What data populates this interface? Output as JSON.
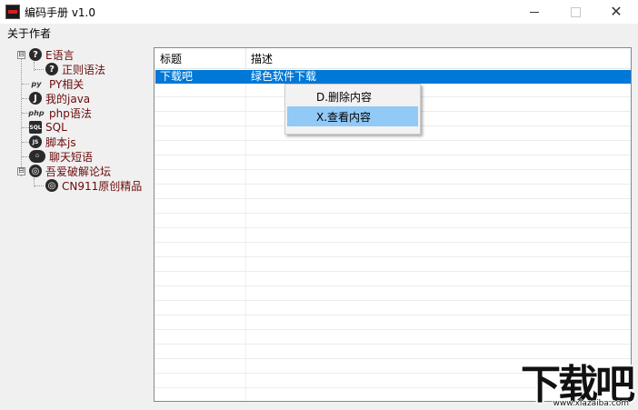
{
  "window": {
    "title": "编码手册 v1.0",
    "minimize_glyph": "",
    "close_glyph": "✕"
  },
  "menu": {
    "items": [
      "关于作者"
    ]
  },
  "tree": {
    "nodes": [
      {
        "label": "E语言",
        "icon": "question-icon",
        "glyph": "?",
        "expander": "⊟"
      },
      {
        "label": "正则语法",
        "icon": "question-icon",
        "glyph": "?"
      },
      {
        "label": "PY相关",
        "icon": "python-icon",
        "glyph": "py"
      },
      {
        "label": "我的java",
        "icon": "java-icon",
        "glyph": "J"
      },
      {
        "label": "php语法",
        "icon": "php-icon",
        "glyph": "php"
      },
      {
        "label": "SQL",
        "icon": "sql-icon",
        "glyph": "SQL"
      },
      {
        "label": "脚本js",
        "icon": "js-icon",
        "glyph": "JS"
      },
      {
        "label": "聊天短语",
        "icon": "chat-icon",
        "glyph": "◦"
      },
      {
        "label": "吾爱破解论坛",
        "icon": "forum-icon",
        "glyph": "◎",
        "expander": "⊟"
      },
      {
        "label": "CN911原创精品",
        "icon": "forum-icon",
        "glyph": "◎"
      }
    ]
  },
  "list": {
    "columns": [
      "标题",
      "描述"
    ],
    "rows": [
      {
        "title": "下载吧",
        "description": "绿色软件下载",
        "selected": true
      }
    ]
  },
  "context_menu": {
    "items": [
      {
        "label": "D.删除内容",
        "highlighted": false
      },
      {
        "label": "X.查看内容",
        "highlighted": true
      }
    ]
  },
  "watermark": {
    "logo_text": "下载吧",
    "url": "www.xiazaiba.com"
  },
  "colors": {
    "selection": "#0078d7",
    "context_highlight": "#91c9f7",
    "tree_text": "#6b0a0a"
  }
}
